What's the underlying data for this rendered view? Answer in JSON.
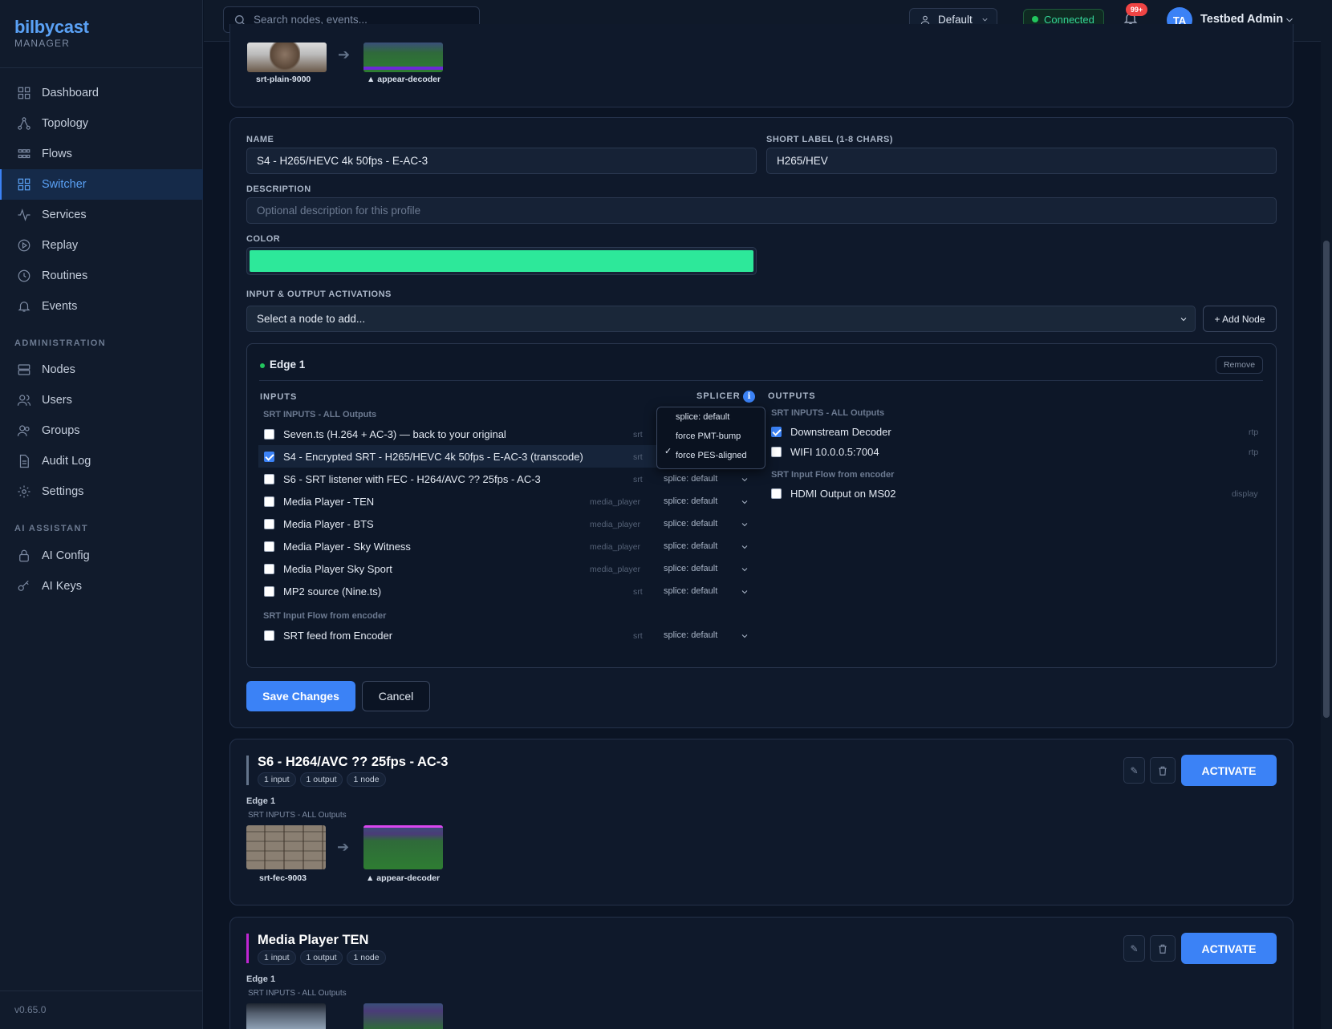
{
  "app": {
    "name": "bilbycast",
    "sub": "MANAGER",
    "version": "v0.65.0"
  },
  "nav": {
    "main": [
      {
        "label": "Dashboard",
        "icon": "grid-icon"
      },
      {
        "label": "Topology",
        "icon": "topology-icon"
      },
      {
        "label": "Flows",
        "icon": "flows-icon"
      },
      {
        "label": "Switcher",
        "icon": "switcher-icon",
        "active": true
      },
      {
        "label": "Services",
        "icon": "activity-icon"
      },
      {
        "label": "Replay",
        "icon": "play-circle-icon"
      },
      {
        "label": "Routines",
        "icon": "clock-icon"
      },
      {
        "label": "Events",
        "icon": "bell-icon"
      }
    ],
    "admin_head": "ADMINISTRATION",
    "admin": [
      {
        "label": "Nodes",
        "icon": "server-icon"
      },
      {
        "label": "Users",
        "icon": "users-icon"
      },
      {
        "label": "Groups",
        "icon": "groups-icon"
      },
      {
        "label": "Audit Log",
        "icon": "file-icon"
      },
      {
        "label": "Settings",
        "icon": "gear-icon"
      }
    ],
    "ai_head": "AI ASSISTANT",
    "ai": [
      {
        "label": "AI Config",
        "icon": "lock-icon"
      },
      {
        "label": "AI Keys",
        "icon": "key-icon"
      }
    ]
  },
  "topbar": {
    "search_placeholder": "Search nodes, events...",
    "context": "Default",
    "status": "Connected",
    "notif_count": "99+",
    "avatar": "TA",
    "user": "Testbed Admin"
  },
  "top_card": {
    "src_label": "srt-plain-9000",
    "dst_label": "▲ appear-decoder"
  },
  "form": {
    "name_label": "NAME",
    "name_value": "S4 - H265/HEVC 4k 50fps - E-AC-3",
    "short_label": "SHORT LABEL (1-8 CHARS)",
    "short_value": "H265/HEV",
    "desc_label": "DESCRIPTION",
    "desc_placeholder": "Optional description for this profile",
    "color_label": "COLOR",
    "color_value": "#2de89a",
    "act_label": "INPUT & OUTPUT ACTIVATIONS",
    "select_placeholder": "Select a node to add...",
    "add_node": "+ Add Node",
    "edge_name": "Edge 1",
    "remove": "Remove",
    "inputs_head": "INPUTS",
    "splicer_head": "SPLICER",
    "outputs_head": "OUTPUTS",
    "input_group1": "SRT INPUTS - ALL Outputs",
    "input_group2": "SRT Input Flow from encoder",
    "inputs": [
      {
        "name": "Seven.ts (H.264 + AC-3) — back to your original",
        "type": "srt",
        "splice": "",
        "checked": false
      },
      {
        "name": "S4 - Encrypted SRT - H265/HEVC 4k 50fps - E-AC-3 (transcode)",
        "type": "srt",
        "splice": "",
        "checked": true
      },
      {
        "name": "S6 - SRT listener with FEC - H264/AVC ?? 25fps - AC-3",
        "type": "srt",
        "splice": "splice: default",
        "checked": false
      },
      {
        "name": "Media Player - TEN",
        "type": "media_player",
        "splice": "splice: default",
        "checked": false
      },
      {
        "name": "Media Player - BTS",
        "type": "media_player",
        "splice": "splice: default",
        "checked": false
      },
      {
        "name": "Media Player - Sky Witness",
        "type": "media_player",
        "splice": "splice: default",
        "checked": false
      },
      {
        "name": "Media Player Sky Sport",
        "type": "media_player",
        "splice": "splice: default",
        "checked": false
      },
      {
        "name": "MP2 source (Nine.ts)",
        "type": "srt",
        "splice": "splice: default",
        "checked": false
      },
      {
        "name": "SRT feed from Encoder",
        "type": "srt",
        "splice": "splice: default",
        "checked": false
      }
    ],
    "output_group1": "SRT INPUTS - ALL Outputs",
    "output_group2": "SRT Input Flow from encoder",
    "outputs": [
      {
        "name": "Downstream Decoder",
        "type": "rtp",
        "checked": true
      },
      {
        "name": "WIFI 10.0.0.5:7004",
        "type": "rtp",
        "checked": false
      },
      {
        "name": "HDMI Output on MS02",
        "type": "display",
        "checked": false
      }
    ],
    "splice_menu": [
      "splice: default",
      "force PMT-bump",
      "force PES-aligned"
    ],
    "splice_menu_selected": "force PES-aligned",
    "save": "Save Changes",
    "cancel": "Cancel"
  },
  "profiles": [
    {
      "title": "S6 - H264/AVC ?? 25fps - AC-3",
      "accent": "#64748b",
      "pills": [
        "1 input",
        "1 output",
        "1 node"
      ],
      "edge": "Edge 1",
      "group": "SRT INPUTS - ALL Outputs",
      "src": "srt-fec-9003",
      "dst": "▲ appear-decoder",
      "activate": "ACTIVATE"
    },
    {
      "title": "Media Player TEN",
      "accent": "#c026d3",
      "pills": [
        "1 input",
        "1 output",
        "1 node"
      ],
      "edge": "Edge 1",
      "group": "SRT INPUTS - ALL Outputs",
      "activate": "ACTIVATE"
    }
  ]
}
